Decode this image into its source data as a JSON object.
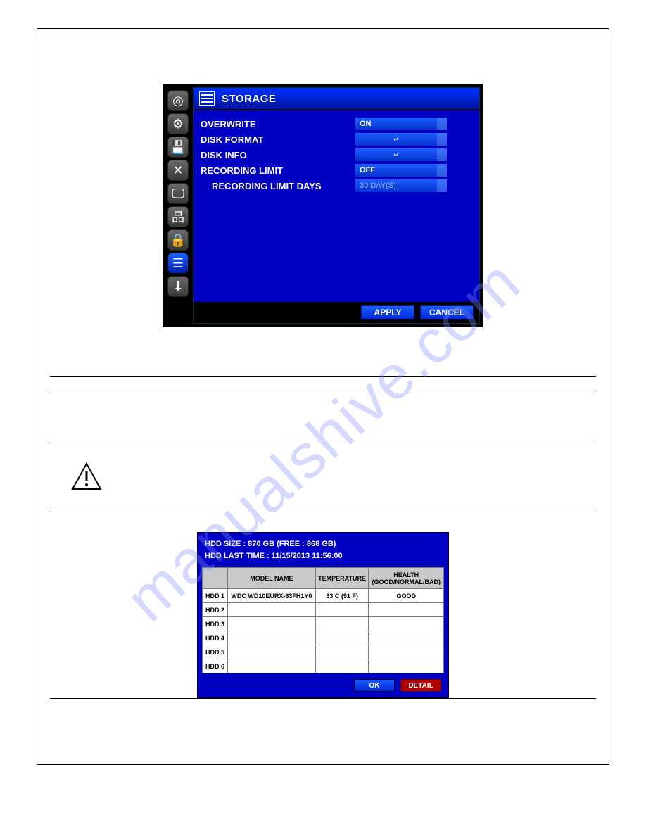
{
  "watermark": "manualshive.com",
  "storage_screen": {
    "title": "STORAGE",
    "rows": {
      "overwrite_label": "OVERWRITE",
      "overwrite_value": "ON",
      "disk_format_label": "DISK FORMAT",
      "disk_format_value": "",
      "disk_info_label": "DISK INFO",
      "disk_info_value": "",
      "recording_limit_label": "RECORDING LIMIT",
      "recording_limit_value": "OFF",
      "recording_limit_days_label": "RECORDING LIMIT DAYS",
      "recording_limit_days_value": "30 DAY(S)"
    },
    "buttons": {
      "apply": "APPLY",
      "cancel": "CANCEL"
    },
    "sidebar_icons": [
      "camera",
      "gear",
      "save",
      "tools",
      "monitor",
      "network",
      "lock",
      "storage",
      "download"
    ]
  },
  "disk_info_screen": {
    "hdd_size": "HDD SIZE : 870 GB (FREE : 868 GB)",
    "hdd_last_time": "HDD LAST TIME : 11/15/2013 11:56:00",
    "headers": {
      "model": "MODEL NAME",
      "temp": "TEMPERATURE",
      "health": "HEALTH\n(GOOD/NORMAL/BAD)"
    },
    "rows": [
      {
        "slot": "HDD 1",
        "model": "WDC WD10EURX-63FH1Y0",
        "temp": "33 C (91 F)",
        "health": "GOOD"
      },
      {
        "slot": "HDD 2",
        "model": "",
        "temp": "",
        "health": ""
      },
      {
        "slot": "HDD 3",
        "model": "",
        "temp": "",
        "health": ""
      },
      {
        "slot": "HDD 4",
        "model": "",
        "temp": "",
        "health": ""
      },
      {
        "slot": "HDD 5",
        "model": "",
        "temp": "",
        "health": ""
      },
      {
        "slot": "HDD 6",
        "model": "",
        "temp": "",
        "health": ""
      }
    ],
    "buttons": {
      "ok": "OK",
      "detail": "DETAIL"
    }
  }
}
